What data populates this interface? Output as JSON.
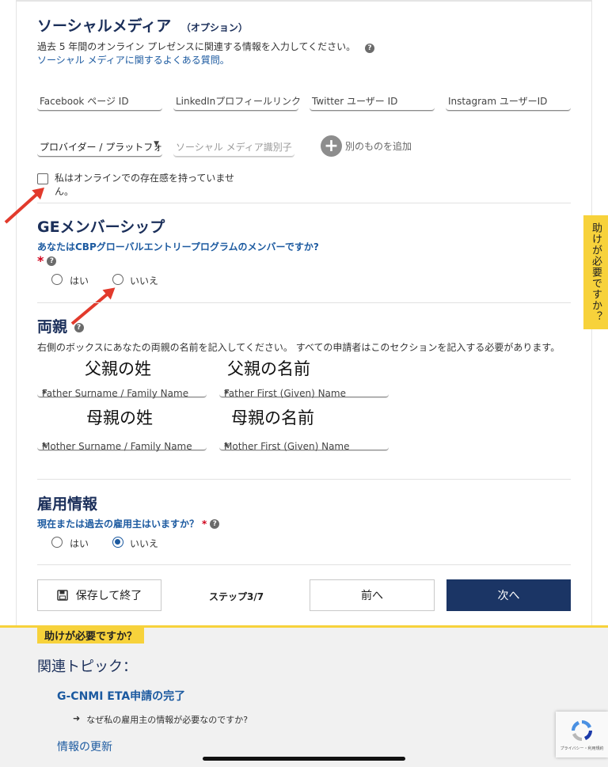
{
  "social": {
    "title": "ソーシャルメディア",
    "title_optional": "（オプション）",
    "description": "過去 5 年間のオンライン プレゼンスに関連する情報を入力してください。",
    "faq_link": "ソーシャル メディアに関するよくある質問。",
    "fields": [
      "Facebook ページ ID",
      "LinkedInプロフィールリンク",
      "Twitter ユーザー ID",
      "Instagram ユーザーID"
    ],
    "provider_select": "プロバイダー / プラットフォ",
    "identifier_placeholder": "ソーシャル メディア識別子",
    "add_other": "別のものを追加",
    "no_presence_line1": "私はオンラインでの存在感を持っていませ",
    "no_presence_line2": "ん。"
  },
  "ge": {
    "title": "GEメンバーシップ",
    "question": "あなたはCBPグローバルエントリープログラムのメンバーですか?",
    "required_mark": "*",
    "yes": "はい",
    "no": "いいえ"
  },
  "parents": {
    "title": "両親",
    "description": "右側のボックスにあなたの両親の名前を記入してください。 すべての申請者はこのセクションを記入する必要があります。",
    "father_surname_caption": "父親の姓",
    "father_given_caption": "父親の名前",
    "mother_surname_caption": "母親の姓",
    "mother_given_caption": "母親の名前",
    "father_surname_label": "Father Surname / Family Name",
    "father_given_label": "Father First (Given) Name",
    "mother_surname_label": "Mother Surname / Family Name",
    "mother_given_label": "Mother First (Given) Name",
    "required_mark": "*"
  },
  "employment": {
    "title": "雇用情報",
    "question": "現在または過去の雇用主はいますか？",
    "required_mark": "*",
    "yes": "はい",
    "no": "いいえ",
    "selected": "いいえ"
  },
  "nav": {
    "save_exit": "保存して終了",
    "step": "ステップ3/7",
    "prev": "前へ",
    "next": "次へ"
  },
  "side_tab": "助けが必要ですか？",
  "help": {
    "badge": "助けが必要ですか？",
    "related_title": "関連トピック：",
    "topic1": "G-CNMI ETA申請の完了",
    "subtopic1": "なぜ私の雇用主の情報が必要なのですか?",
    "topic2": "情報の更新"
  },
  "recaptcha": {
    "text": "プライバシー・利用規約"
  },
  "colors": {
    "heading": "#1b2f5a",
    "link": "#1c5aa0",
    "primary": "#1b3565",
    "accent_yellow": "#f7d23b",
    "help_bg": "#f1f1f1",
    "required": "#d0021b",
    "annotation_arrow": "#e23a2c"
  }
}
